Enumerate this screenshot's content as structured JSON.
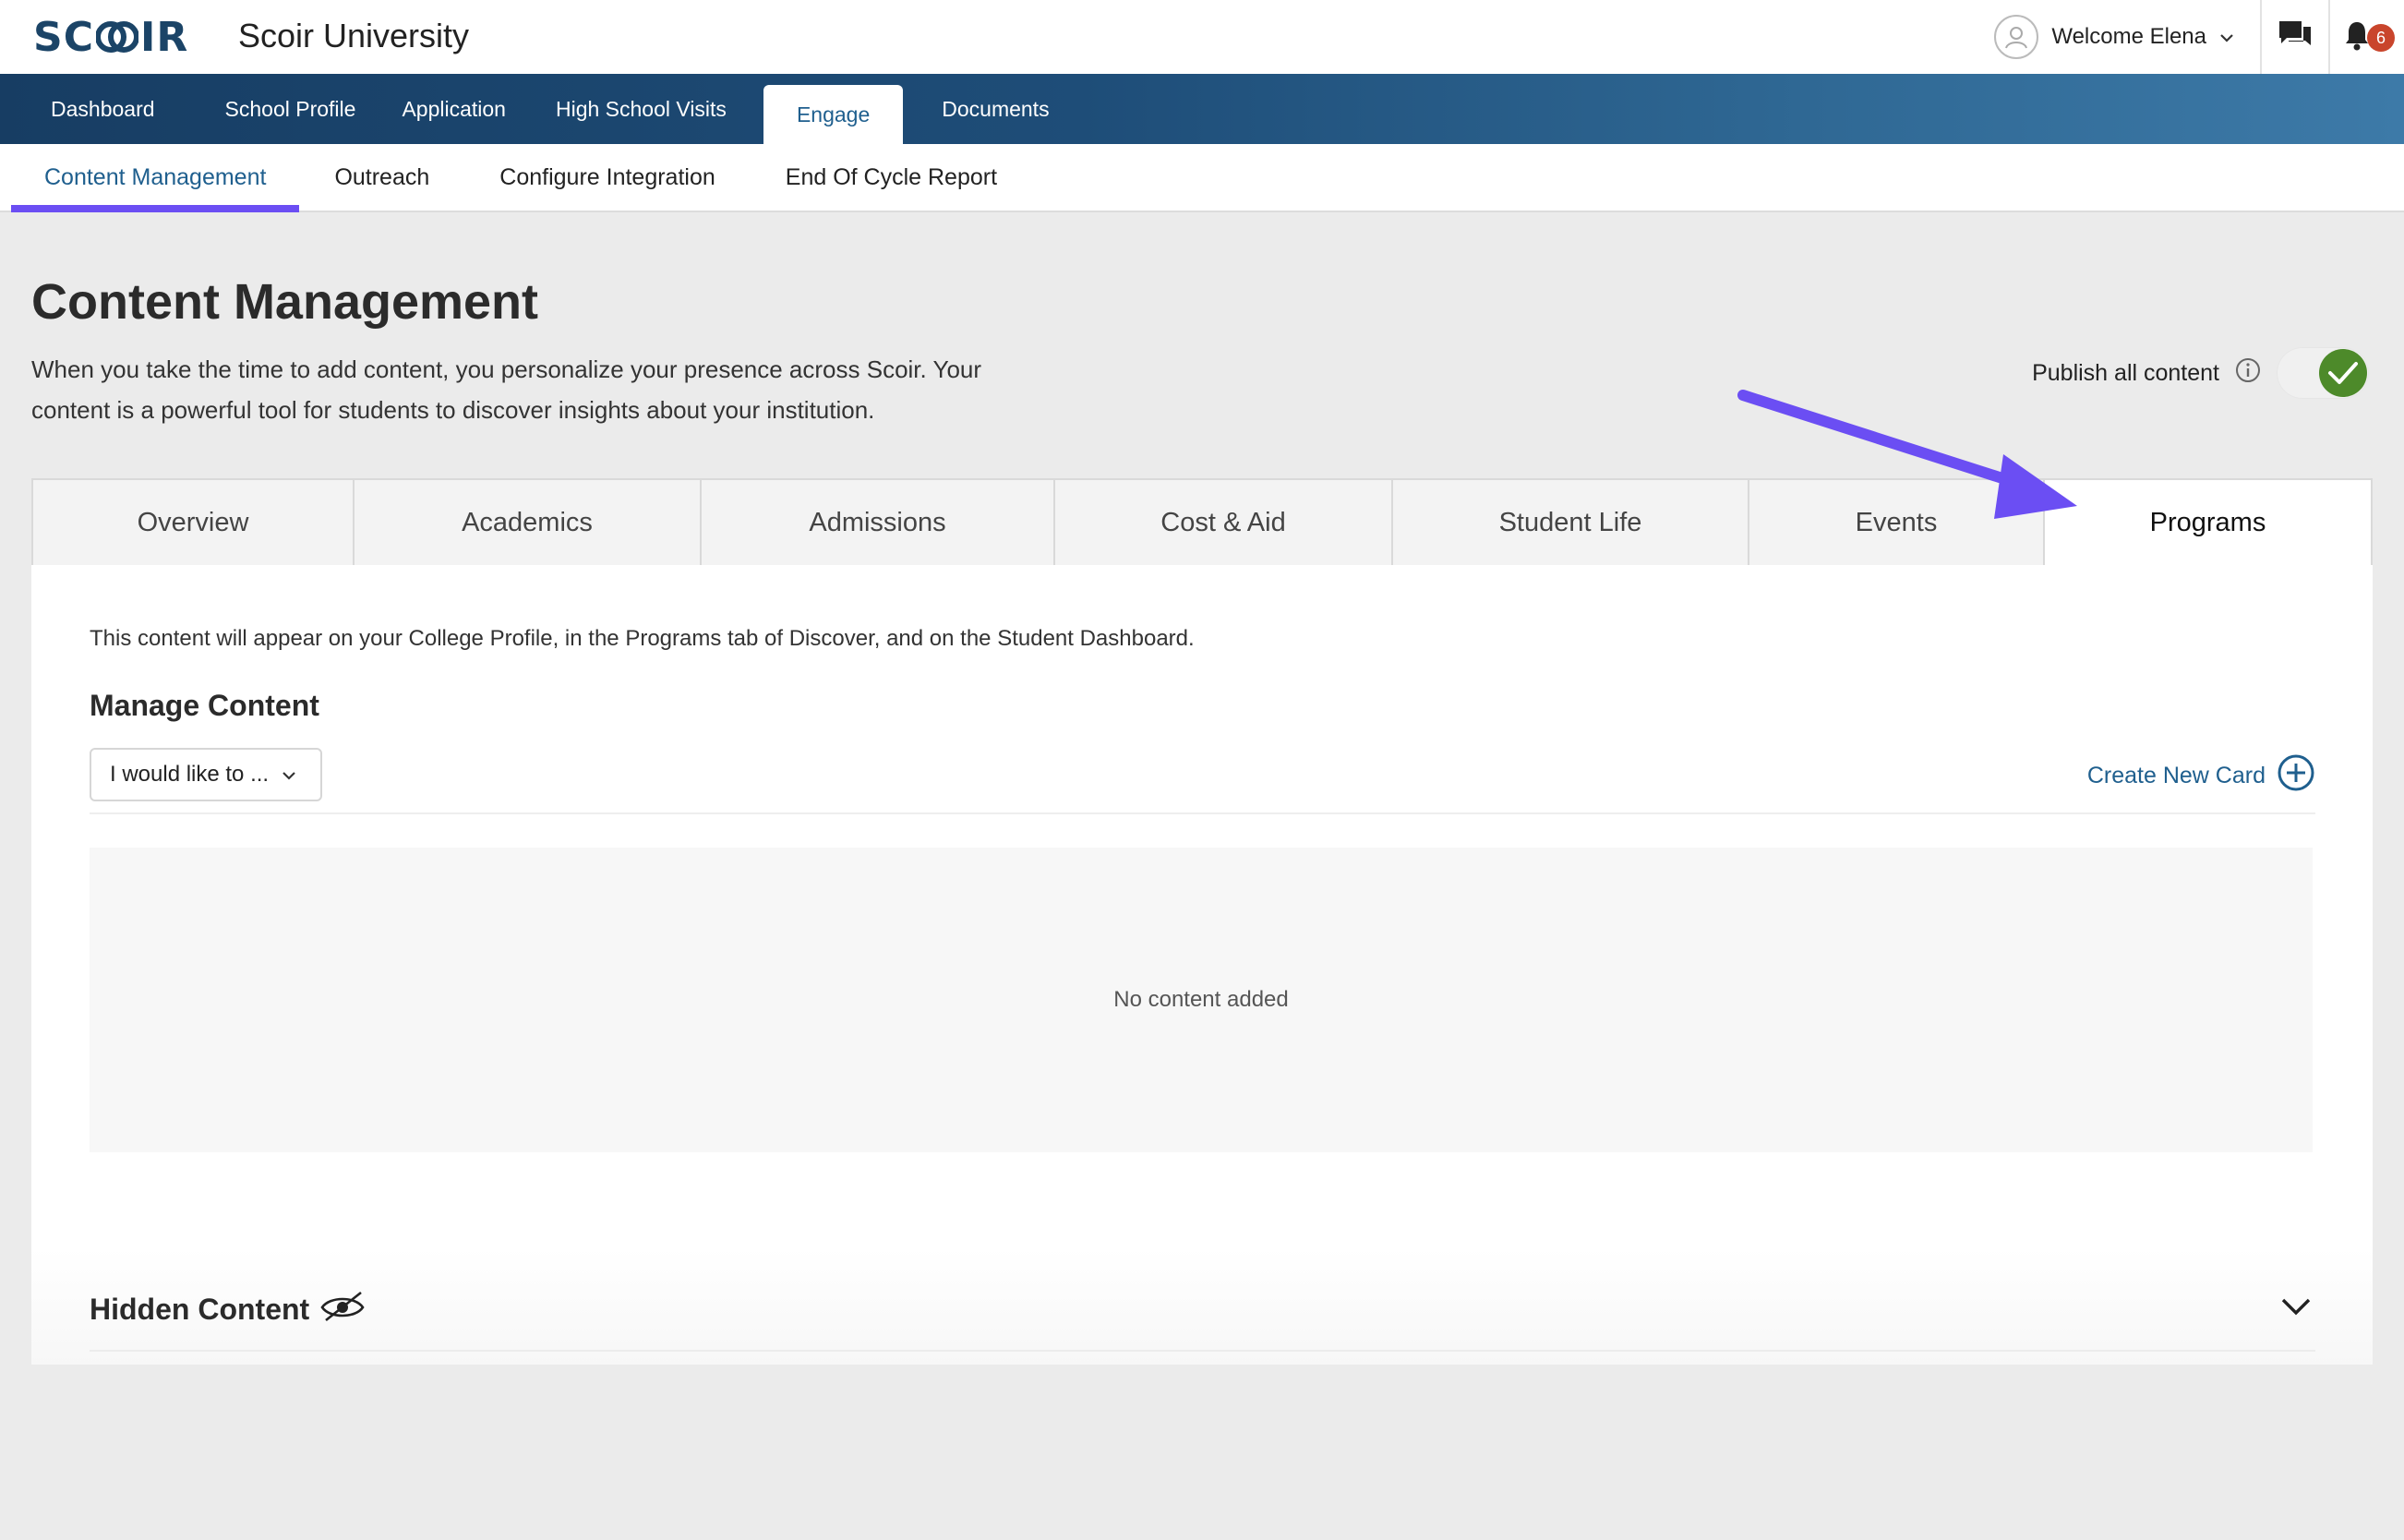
{
  "brand": {
    "logo_text_left": "SC",
    "logo_text_right": "IR",
    "university": "Scoir University"
  },
  "user": {
    "welcome": "Welcome Elena",
    "notification_count": "6"
  },
  "main_nav": [
    {
      "label": "Dashboard"
    },
    {
      "label": "School Profile"
    },
    {
      "label": "Application"
    },
    {
      "label": "High School Visits"
    },
    {
      "label": "Engage"
    },
    {
      "label": "Documents"
    }
  ],
  "sub_nav": [
    {
      "label": "Content Management"
    },
    {
      "label": "Outreach"
    },
    {
      "label": "Configure Integration"
    },
    {
      "label": "End Of Cycle Report"
    }
  ],
  "page": {
    "title": "Content Management",
    "description": "When you take the time to add content, you personalize your presence across Scoir. Your content is a powerful tool for students to discover insights about your institution.",
    "publish_label": "Publish all content",
    "publish_on": true
  },
  "tabs": [
    {
      "label": "Overview"
    },
    {
      "label": "Academics"
    },
    {
      "label": "Admissions"
    },
    {
      "label": "Cost & Aid"
    },
    {
      "label": "Student Life"
    },
    {
      "label": "Events"
    },
    {
      "label": "Programs"
    }
  ],
  "panel": {
    "note": "This content will appear on your College Profile, in the Programs tab of Discover, and on the Student Dashboard.",
    "manage_title": "Manage Content",
    "select_value": "I would like to ...",
    "create_label": "Create New Card",
    "empty_text": "No content added",
    "hidden_title": "Hidden Content"
  },
  "colors": {
    "accent_purple": "#6b4ef3",
    "brand_blue": "#1b4467",
    "link_blue": "#1f5f8e",
    "toggle_green": "#4d8a2a",
    "badge_red": "#c9452c"
  }
}
